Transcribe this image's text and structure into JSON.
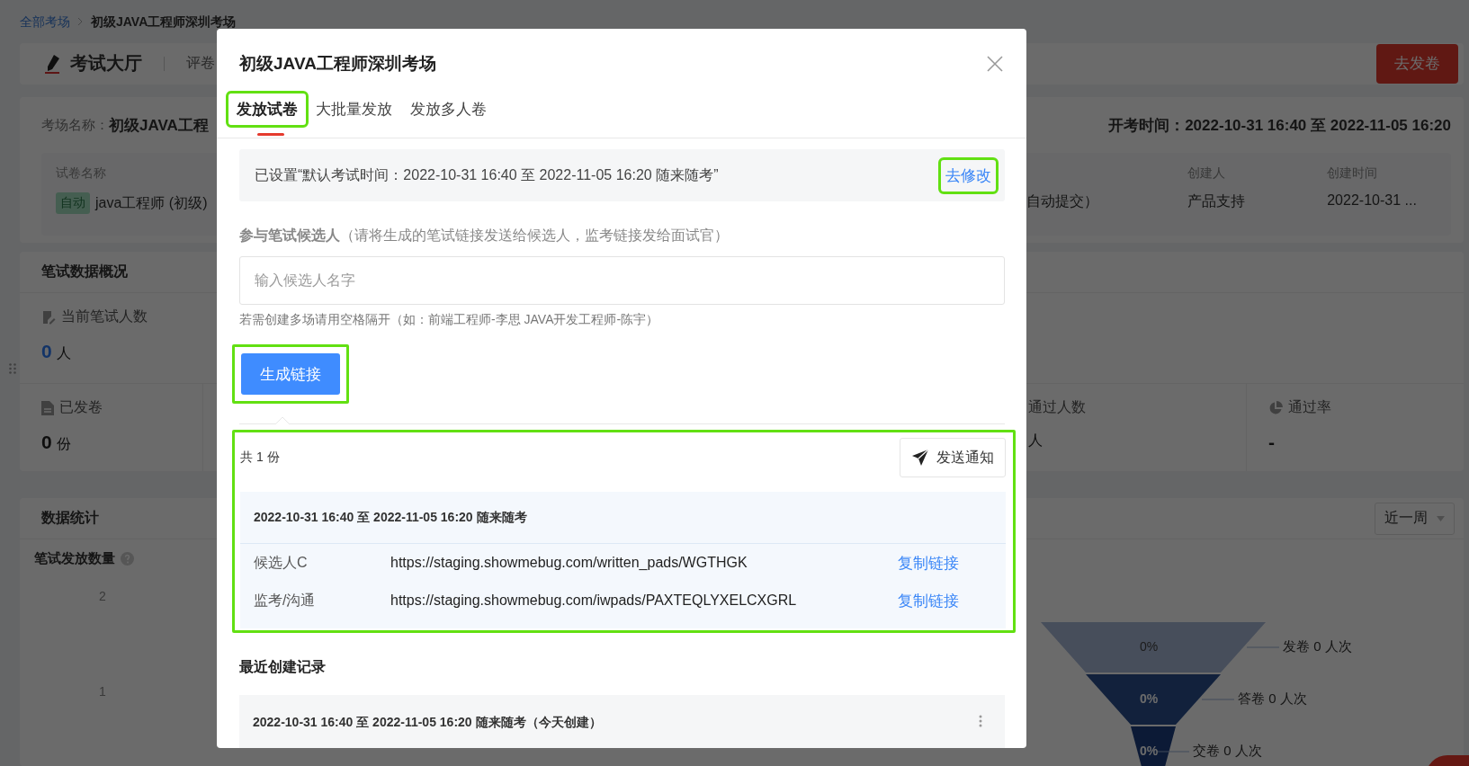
{
  "breadcrumb": [
    {
      "label": "全部考场",
      "kind": "link"
    },
    {
      "label": "初级JAVA工程师深圳考场",
      "kind": "current"
    }
  ],
  "header": {
    "title": "考试大厅",
    "tab": "评卷",
    "action": "去发卷"
  },
  "exam_info": {
    "name_label": "考场名称：",
    "name": "初级JAVA工程",
    "time_label": "开考时间：",
    "time": "2022-10-31 16:40 至 2022-11-05 16:20",
    "fields": [
      {
        "label": "试卷名称",
        "tag": "自动",
        "value": "java工程师 (初级)"
      },
      {
        "value": "自动提交）"
      },
      {
        "label": "创建人",
        "value": "产品支持"
      },
      {
        "label": "创建时间",
        "value": "2022-10-31 ..."
      }
    ]
  },
  "overview": {
    "title": "笔试数据概况",
    "rows": [
      {
        "stats": [
          {
            "label": "当前笔试人数",
            "value": "0",
            "unit": "人",
            "accent": true
          }
        ]
      },
      {
        "stats": [
          {
            "label": "已发卷",
            "value": "0",
            "unit": "份",
            "accent": false
          },
          {
            "label": "通过人数",
            "unit": "人"
          },
          {
            "label": "通过率",
            "value": "-",
            "accent": false
          }
        ]
      }
    ]
  },
  "statistics": {
    "title": "数据统计",
    "range": "近一周",
    "chart_title": "笔试发放数量",
    "y_labels": [
      "2",
      "1"
    ],
    "funnel": [
      {
        "percent": "0%",
        "label": "发卷 0 人次"
      },
      {
        "percent": "0%",
        "label": "答卷 0 人次"
      },
      {
        "percent": "0%",
        "label": "交卷 0 人次"
      }
    ]
  },
  "dialog": {
    "title": "初级JAVA工程师深圳考场",
    "tabs": [
      {
        "label": "发放试卷",
        "selected": true,
        "marked": true
      },
      {
        "label": "大批量发放",
        "selected": false,
        "marked": false
      },
      {
        "label": "发放多人卷",
        "selected": false,
        "marked": false
      }
    ],
    "notice": {
      "text": "已设置“默认考试时间：2022-10-31 16:40 至 2022-11-05 16:20 随来随考”",
      "link": "去修改",
      "marked": true
    },
    "candidates": {
      "label": "**参与笔试候选人**（请将生成的笔试链接发送给候选人，监考链接发给面试官）",
      "placeholder": "输入候选人名字",
      "hint": "若需创建多场请用空格隔开（如：前端工程师-李思 JAVA开发工程师-陈宇）",
      "button": "生成链接",
      "button_marked": true
    },
    "result": {
      "marked": true,
      "count": "共 1 份",
      "notify": "发送通知",
      "session": "2022-10-31 16:40 至 2022-11-05 16:20 随来随考",
      "links": [
        {
          "role": "候选人C",
          "url": "https://staging.showmebug.com/written_pads/WGTHGK",
          "action": "复制链接"
        },
        {
          "role": "监考/沟通",
          "url": "https://staging.showmebug.com/iwpads/PAXTEQLYXELCXGRL",
          "action": "复制链接"
        }
      ]
    },
    "recent": {
      "title": "最近创建记录",
      "records": [
        {
          "text": "2022-10-31 16:40 至 2022-11-05 16:20 随来随考（今天创建）"
        }
      ]
    }
  }
}
